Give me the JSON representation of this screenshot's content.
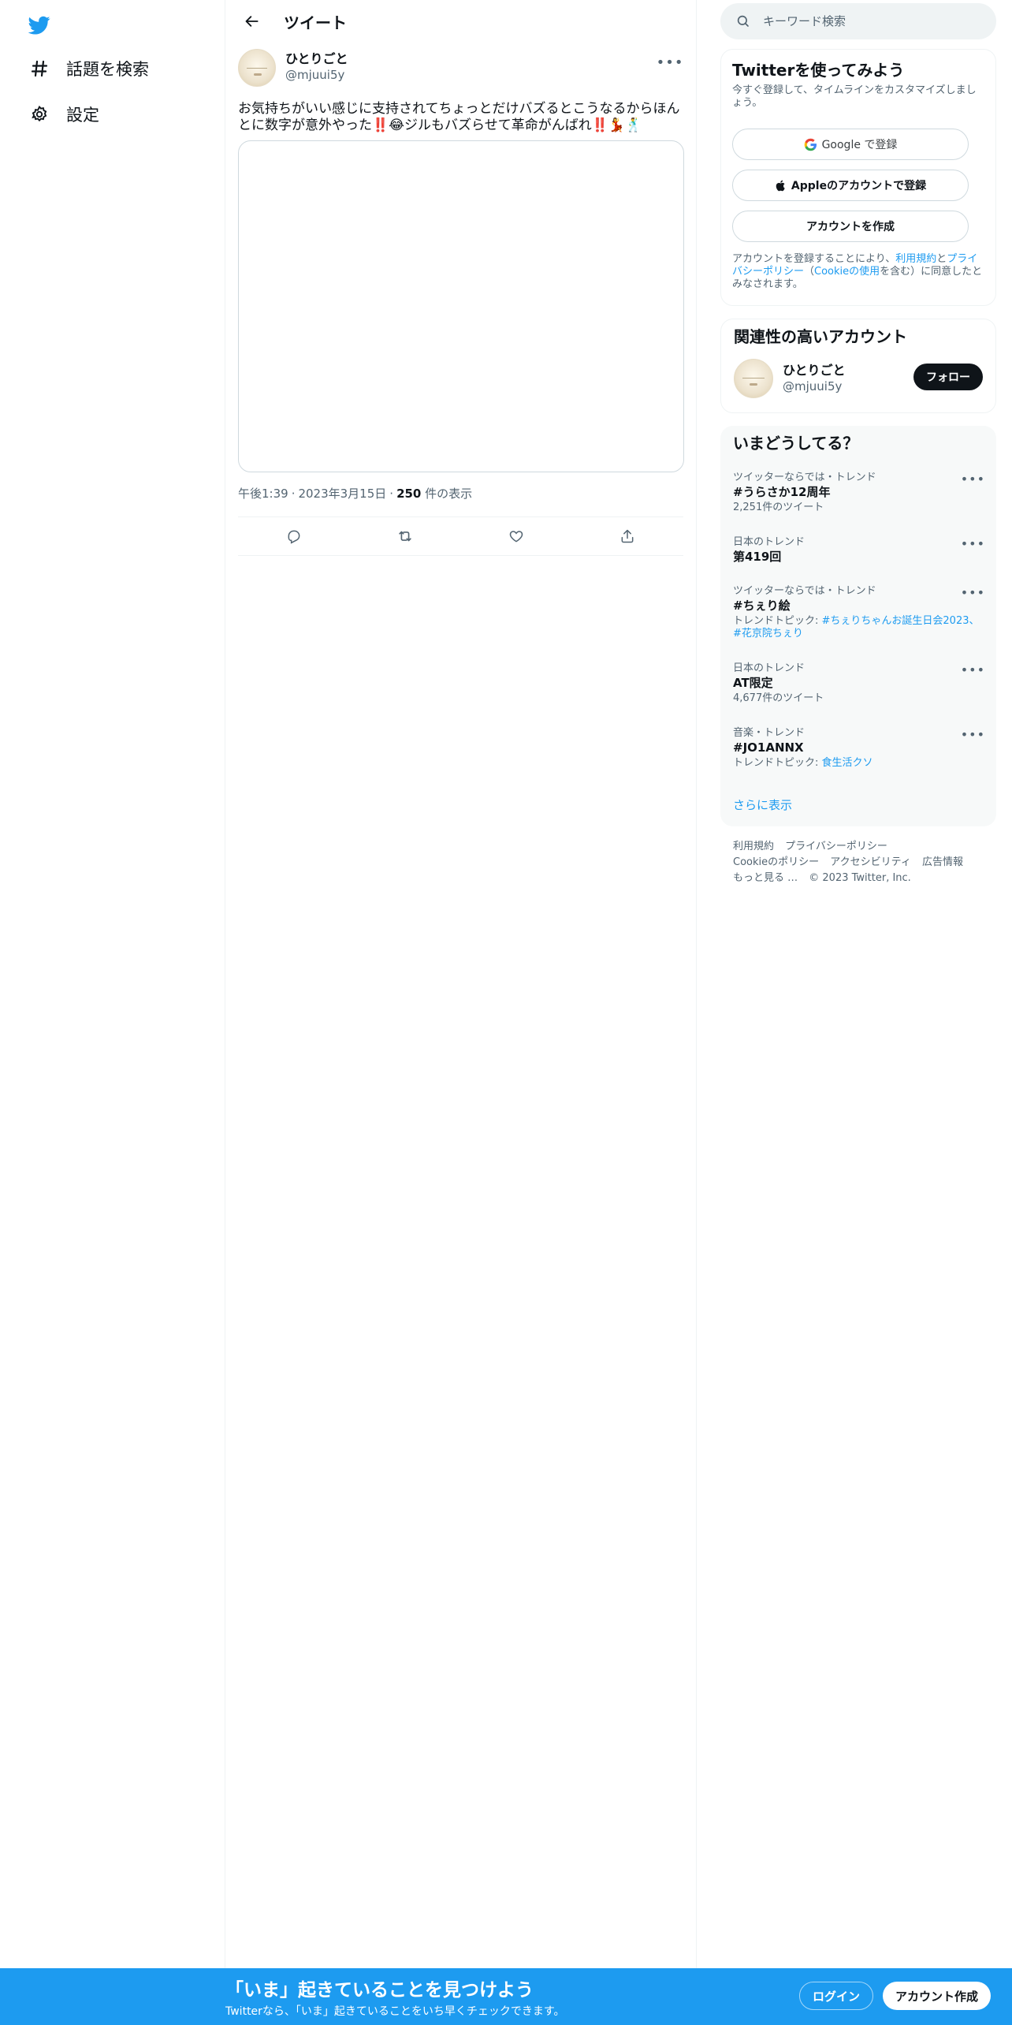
{
  "nav": {
    "logo": "twitter-bird-icon",
    "items": [
      {
        "icon": "hashtag-icon",
        "label": "話題を検索"
      },
      {
        "icon": "gear-icon",
        "label": "設定"
      }
    ]
  },
  "header": {
    "title": "ツイート"
  },
  "tweet": {
    "display_name": "ひとりごと",
    "handle": "@mjuui5y",
    "text": "お気持ちがいい感じに支持されてちょっとだけバズるとこうなるからほんとに数字が意外やった‼️😂ジルもバズらせて革命がんばれ‼️💃🕺",
    "time": "午後1:39",
    "date": "2023年3月15日",
    "views_count": "250",
    "views_label": "件の表示"
  },
  "search": {
    "placeholder": "キーワード検索"
  },
  "signup": {
    "title": "Twitterを使ってみよう",
    "subtitle": "今すぐ登録して、タイムラインをカスタマイズしましょう。",
    "google_label": "Google で登録",
    "apple_label": "Appleのアカウントで登録",
    "create_label": "アカウントを作成",
    "terms_prefix": "アカウントを登録することにより、",
    "terms_link": "利用規約",
    "terms_and": "と",
    "privacy_link": "プライバシーポリシー",
    "cookie_open": "（",
    "cookie_link": "Cookieの使用",
    "terms_suffix": "を含む）に同意したとみなされます。"
  },
  "related": {
    "title": "関連性の高いアカウント",
    "display_name": "ひとりごと",
    "handle": "@mjuui5y",
    "follow_label": "フォロー"
  },
  "trends": {
    "title": "いまどうしてる？",
    "items": [
      {
        "context": "ツイッターならでは・トレンド",
        "name": "#うらさか12周年",
        "sub": "2,251件のツイート"
      },
      {
        "context": "日本のトレンド",
        "name": "第419回",
        "sub": ""
      },
      {
        "context": "ツイッターならでは・トレンド",
        "name": "#ちぇり絵",
        "sub_prefix": "トレンドトピック: ",
        "sub_link": "#ちぇりちゃんお誕生日会2023、#花京院ちぇり"
      },
      {
        "context": "日本のトレンド",
        "name": "AT限定",
        "sub": "4,677件のツイート"
      },
      {
        "context": "音楽・トレンド",
        "name": "#JO1ANNX",
        "sub_prefix": "トレンドトピック: ",
        "sub_link": "食生活クソ"
      }
    ],
    "show_more": "さらに表示"
  },
  "footer": {
    "links": [
      "利用規約",
      "プライバシーポリシー",
      "Cookieのポリシー",
      "アクセシビリティ",
      "広告情報",
      "もっと見る …"
    ],
    "copyright": "© 2023 Twitter, Inc."
  },
  "bottom_bar": {
    "title": "「いま」起きていることを見つけよう",
    "subtitle": "Twitterなら、「いま」起きていることをいち早くチェックできます。",
    "login_label": "ログイン",
    "signup_label": "アカウント作成"
  },
  "colors": {
    "accent": "#1d9bf0",
    "text": "#0f1419",
    "muted": "#536471"
  }
}
